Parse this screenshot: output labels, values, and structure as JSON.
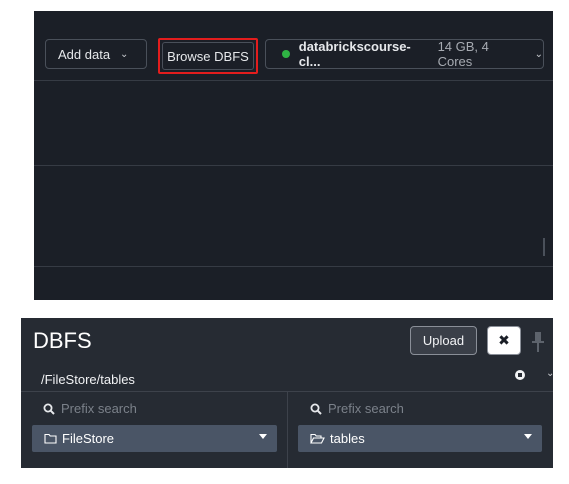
{
  "toolbar": {
    "add_data_label": "Add data",
    "browse_dbfs_label": "Browse DBFS",
    "cluster": {
      "name": "databrickscourse-cl...",
      "spec": "14 GB, 4 Cores",
      "status_color": "#2fb344"
    }
  },
  "highlight_color": "#e31d1d",
  "dbfs": {
    "title": "DBFS",
    "upload_label": "Upload",
    "close_glyph": "✖",
    "path": "/FileStore/tables",
    "columns": [
      {
        "search_placeholder": "Prefix search",
        "selected_folder": "FileStore",
        "folder_state": "closed"
      },
      {
        "search_placeholder": "Prefix search",
        "selected_folder": "tables",
        "folder_state": "open"
      }
    ]
  }
}
